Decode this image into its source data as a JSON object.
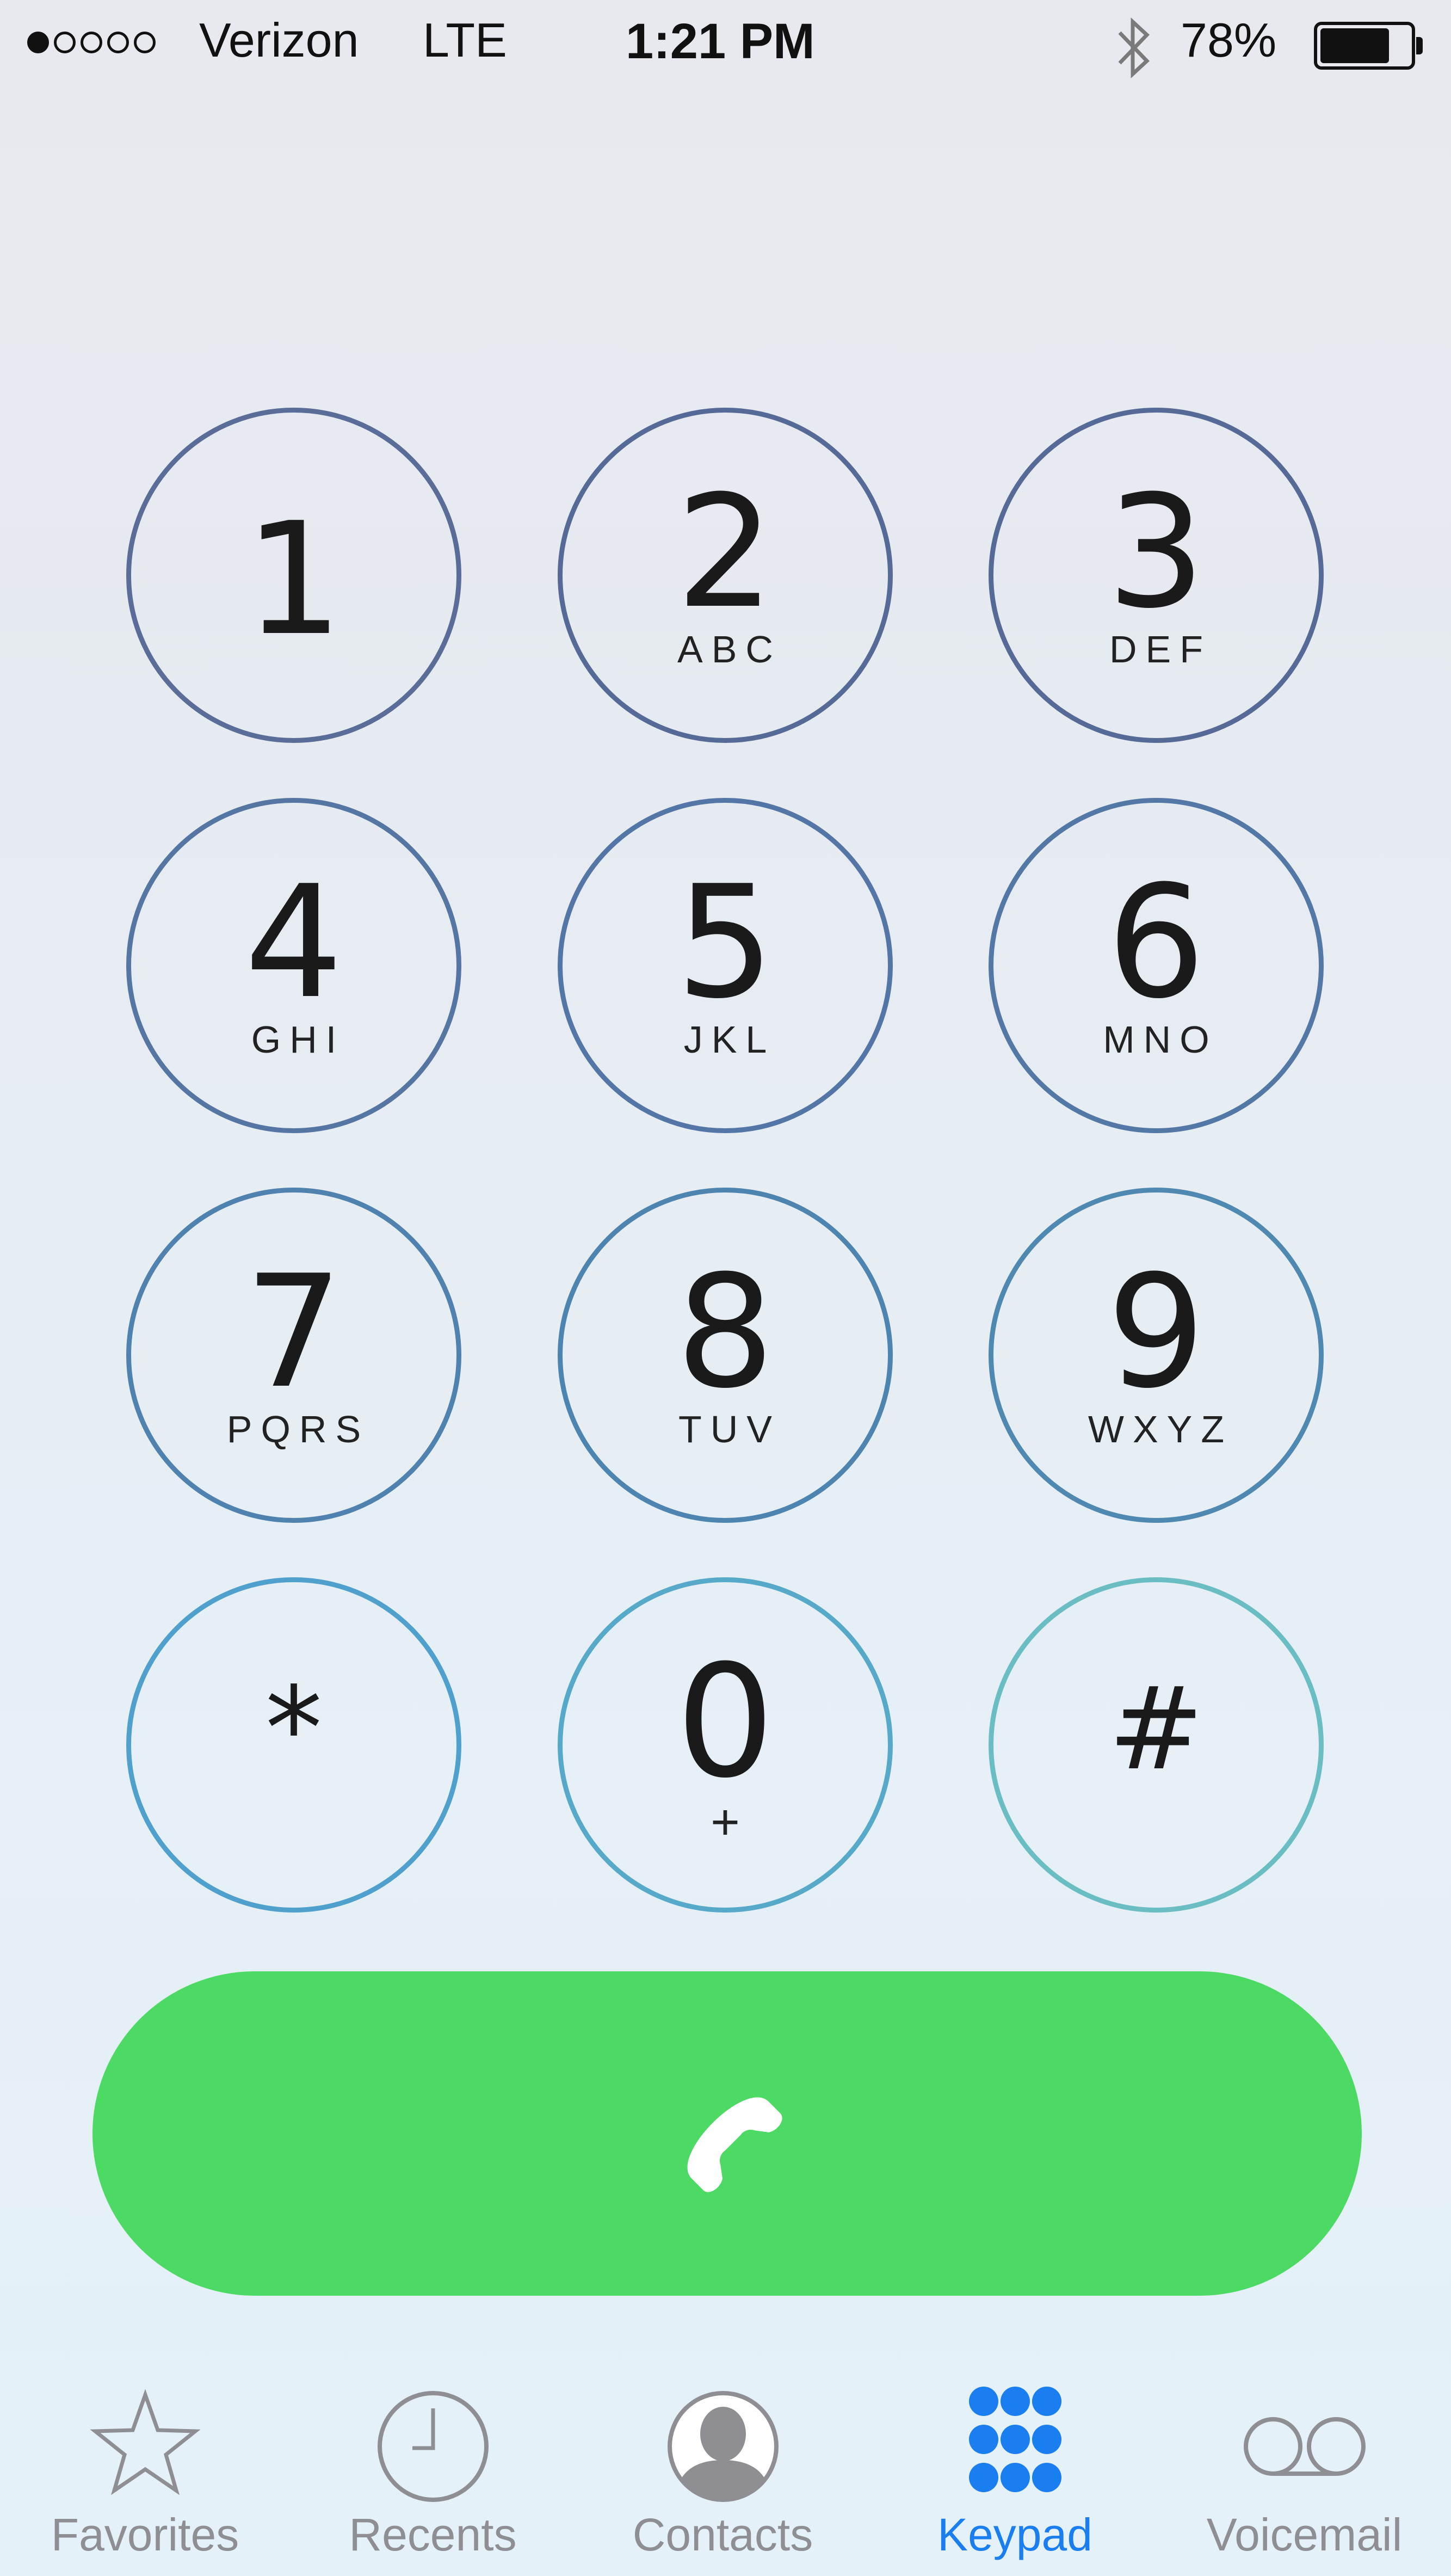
{
  "status_bar": {
    "signal_bars": 1,
    "signal_total": 5,
    "carrier": "Verizon",
    "network": "LTE",
    "time": "1:21 PM",
    "bluetooth_icon": "bluetooth-icon",
    "battery_percent": "78%",
    "battery_level": 0.78
  },
  "keypad": {
    "keys": [
      {
        "digit": "1",
        "letters": ""
      },
      {
        "digit": "2",
        "letters": "ABC"
      },
      {
        "digit": "3",
        "letters": "DEF"
      },
      {
        "digit": "4",
        "letters": "GHI"
      },
      {
        "digit": "5",
        "letters": "JKL"
      },
      {
        "digit": "6",
        "letters": "MNO"
      },
      {
        "digit": "7",
        "letters": "PQRS"
      },
      {
        "digit": "8",
        "letters": "TUV"
      },
      {
        "digit": "9",
        "letters": "WXYZ"
      },
      {
        "digit": "*",
        "letters": ""
      },
      {
        "digit": "0",
        "letters": "+"
      },
      {
        "digit": "#",
        "letters": ""
      }
    ]
  },
  "call_button": {
    "icon": "phone-icon",
    "color": "#4cd964"
  },
  "tab_bar": {
    "tabs": [
      {
        "label": "Favorites",
        "icon": "star-icon",
        "active": false
      },
      {
        "label": "Recents",
        "icon": "clock-icon",
        "active": false
      },
      {
        "label": "Contacts",
        "icon": "contact-silhouette-icon",
        "active": false
      },
      {
        "label": "Keypad",
        "icon": "keypad-grid-icon",
        "active": true
      },
      {
        "label": "Voicemail",
        "icon": "voicemail-icon",
        "active": false
      }
    ],
    "active_color": "#1a7ef1",
    "inactive_color": "#8e8e93"
  }
}
